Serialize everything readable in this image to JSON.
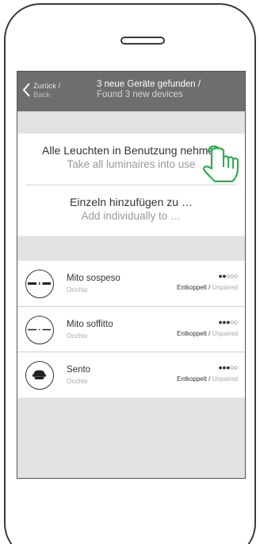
{
  "header": {
    "back_de": "Zurück /",
    "back_en": "Back",
    "title_de": "3 neue Geräte gefunden /",
    "title_en": "Found 3 new devices"
  },
  "actions": [
    {
      "de": "Alle Leuchten in Benutzung nehmen",
      "en": "Take all luminaires into use"
    },
    {
      "de": "Einzeln hinzufügen zu …",
      "en": "Add individually to …"
    }
  ],
  "devices": [
    {
      "name": "Mito sospeso",
      "sub": "Occhio",
      "signal": "●●○○○",
      "status_de": "Entkoppelt",
      "status_sep": " / ",
      "status_en": "Unpaired",
      "icon": "pendant-lamp-icon"
    },
    {
      "name": "Mito soffitto",
      "sub": "Occhio",
      "signal": "●●●○○",
      "status_de": "Entkoppelt",
      "status_sep": " / ",
      "status_en": "Unpaired",
      "icon": "ceiling-lamp-icon"
    },
    {
      "name": "Sento",
      "sub": "Occhio",
      "signal": "●●●○○",
      "status_de": "Entkoppelt",
      "status_sep": " / ",
      "status_en": "Unpaired",
      "icon": "spot-lamp-icon"
    }
  ],
  "colors": {
    "header_bg": "#6e6e6e",
    "screen_bg": "#e2e2e2",
    "hand_accent": "#2fae4e"
  }
}
